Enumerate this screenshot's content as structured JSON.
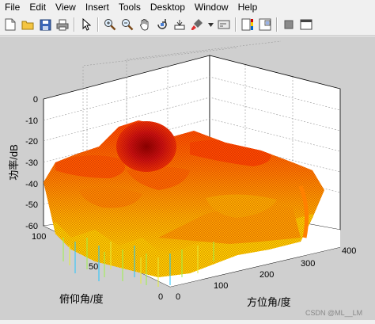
{
  "menu": {
    "items": [
      "File",
      "Edit",
      "View",
      "Insert",
      "Tools",
      "Desktop",
      "Window",
      "Help"
    ]
  },
  "toolbar": {
    "icons": [
      "new-file-icon",
      "open-folder-icon",
      "save-icon",
      "print-icon",
      "select-arrow-icon",
      "zoom-in-icon",
      "zoom-out-icon",
      "pan-hand-icon",
      "rotate-3d-icon",
      "data-cursor-icon",
      "brush-icon",
      "link-icon",
      "colorbar-icon",
      "legend-icon",
      "hide-tools-icon",
      "show-tools-icon"
    ]
  },
  "chart_data": {
    "type": "surface",
    "zlabel": "功率/dB",
    "xlabel": "方位角/度",
    "ylabel": "俯仰角/度",
    "z_ticks": [
      "0",
      "-10",
      "-20",
      "-30",
      "-40",
      "-50",
      "-60"
    ],
    "x_ticks": [
      "0",
      "100",
      "200",
      "300",
      "400"
    ],
    "y_ticks": [
      "0",
      "50",
      "100"
    ],
    "xlim": [
      0,
      400
    ],
    "ylim": [
      0,
      100
    ],
    "zlim": [
      -60,
      0
    ],
    "grid": true,
    "colormap": "jet",
    "colors": {
      "peak": "#8b0000",
      "high": "#ff3b00",
      "mid": "#ff9500",
      "low": "#ffd000",
      "lower": "#9ef24a",
      "lowest": "#22c4ff"
    }
  },
  "watermark": "CSDN @ML__LM"
}
